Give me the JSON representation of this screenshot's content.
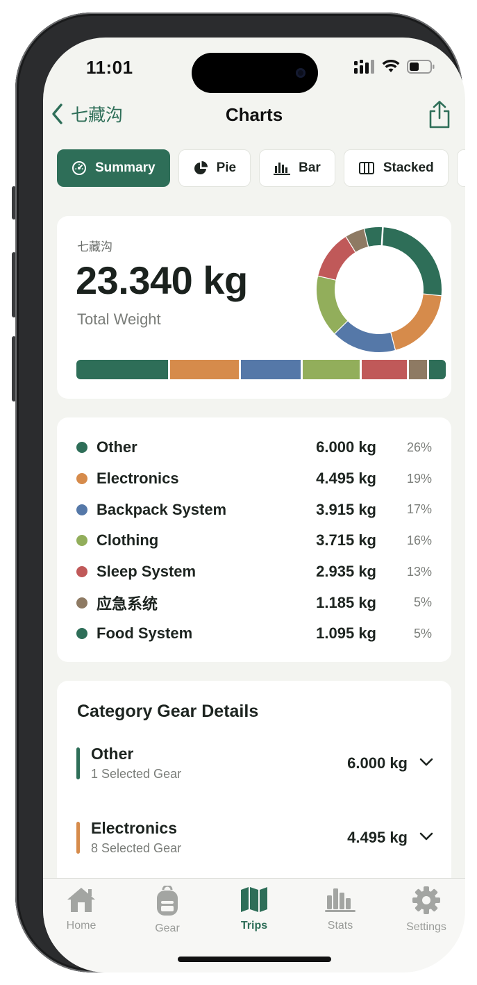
{
  "status_bar": {
    "time": "11:01"
  },
  "nav": {
    "back_label": "七藏沟",
    "title": "Charts"
  },
  "chart_tabs": [
    {
      "label": "Summary",
      "icon": "gauge-icon",
      "active": true
    },
    {
      "label": "Pie",
      "icon": "pie-chart-icon",
      "active": false
    },
    {
      "label": "Bar",
      "icon": "bar-chart-icon",
      "active": false
    },
    {
      "label": "Stacked",
      "icon": "stacked-columns-icon",
      "active": false
    }
  ],
  "summary": {
    "trip_name": "七藏沟",
    "total_weight": "23.340 kg",
    "total_label": "Total Weight"
  },
  "categories": [
    {
      "name": "Other",
      "weight": "6.000 kg",
      "percent": "26%",
      "color": "#2e6e58"
    },
    {
      "name": "Electronics",
      "weight": "4.495 kg",
      "percent": "19%",
      "color": "#d68b4b"
    },
    {
      "name": "Backpack System",
      "weight": "3.915 kg",
      "percent": "17%",
      "color": "#5578a8"
    },
    {
      "name": "Clothing",
      "weight": "3.715 kg",
      "percent": "16%",
      "color": "#92ae5b"
    },
    {
      "name": "Sleep System",
      "weight": "2.935 kg",
      "percent": "13%",
      "color": "#c05959"
    },
    {
      "name": "应急系统",
      "weight": "1.185 kg",
      "percent": "5%",
      "color": "#8e7a63"
    },
    {
      "name": "Food System",
      "weight": "1.095 kg",
      "percent": "5%",
      "color": "#2e6e58"
    }
  ],
  "chart_data": {
    "type": "pie",
    "categories": [
      "Other",
      "Electronics",
      "Backpack System",
      "Clothing",
      "Sleep System",
      "应急系统",
      "Food System"
    ],
    "values": [
      6.0,
      4.495,
      3.915,
      3.715,
      2.935,
      1.185,
      1.095
    ],
    "unit": "kg",
    "donut": true
  },
  "details": {
    "title": "Category Gear Details",
    "rows": [
      {
        "name": "Other",
        "subtitle": "1 Selected Gear",
        "weight": "6.000 kg",
        "color": "#2e6e58"
      },
      {
        "name": "Electronics",
        "subtitle": "8 Selected Gear",
        "weight": "4.495 kg",
        "color": "#d68b4b"
      }
    ]
  },
  "tabbar": [
    {
      "label": "Home",
      "icon": "house-icon",
      "active": false
    },
    {
      "label": "Gear",
      "icon": "backpack-icon",
      "active": false
    },
    {
      "label": "Trips",
      "icon": "map-icon",
      "active": true
    },
    {
      "label": "Stats",
      "icon": "stats-icon",
      "active": false
    },
    {
      "label": "Settings",
      "icon": "gear-icon",
      "active": false
    }
  ],
  "colors": {
    "accent": "#2e6e58",
    "background": "#f3f4f0"
  }
}
